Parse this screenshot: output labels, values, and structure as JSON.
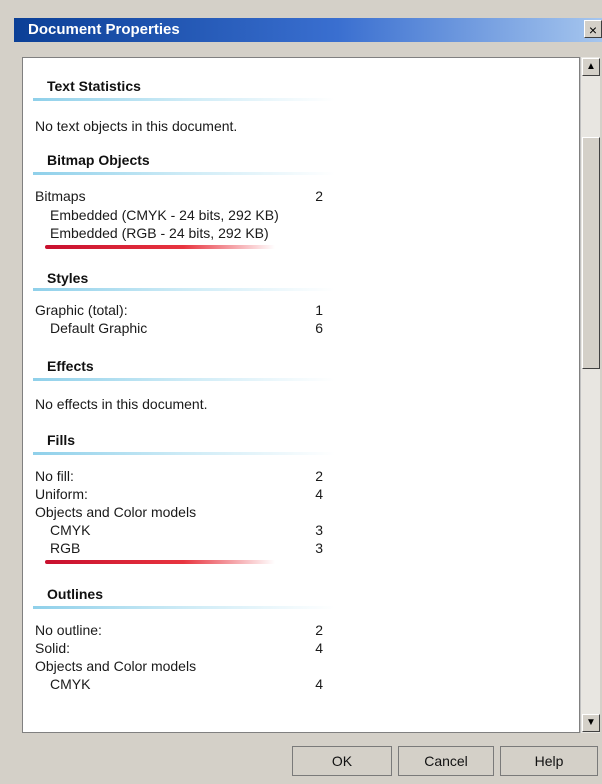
{
  "window": {
    "title": "Document Properties",
    "close_label": "×"
  },
  "sections": {
    "text_statistics": {
      "heading": "Text Statistics",
      "message": "No text objects in this document."
    },
    "bitmap_objects": {
      "heading": "Bitmap Objects",
      "bitmaps_label": "Bitmaps",
      "bitmaps_count": "2",
      "embedded_cmyk": "Embedded (CMYK - 24 bits, 292 KB)",
      "embedded_rgb": "Embedded (RGB - 24 bits, 292 KB)"
    },
    "styles": {
      "heading": "Styles",
      "graphic_total_label": "Graphic (total):",
      "graphic_total_count": "1",
      "default_graphic_label": "Default Graphic",
      "default_graphic_count": "6"
    },
    "effects": {
      "heading": "Effects",
      "message": "No effects in this document."
    },
    "fills": {
      "heading": "Fills",
      "no_fill_label": "No fill:",
      "no_fill_count": "2",
      "uniform_label": "Uniform:",
      "uniform_count": "4",
      "color_models_label": "Objects and Color models",
      "cmyk_label": "CMYK",
      "cmyk_count": "3",
      "rgb_label": "RGB",
      "rgb_count": "3"
    },
    "outlines": {
      "heading": "Outlines",
      "no_outline_label": "No outline:",
      "no_outline_count": "2",
      "solid_label": "Solid:",
      "solid_count": "4",
      "color_models_label": "Objects and Color models",
      "cmyk_label": "CMYK",
      "cmyk_count": "4"
    }
  },
  "buttons": {
    "ok": "OK",
    "cancel": "Cancel",
    "help": "Help"
  },
  "icons": {
    "scroll_up": "▲",
    "scroll_down": "▼"
  }
}
